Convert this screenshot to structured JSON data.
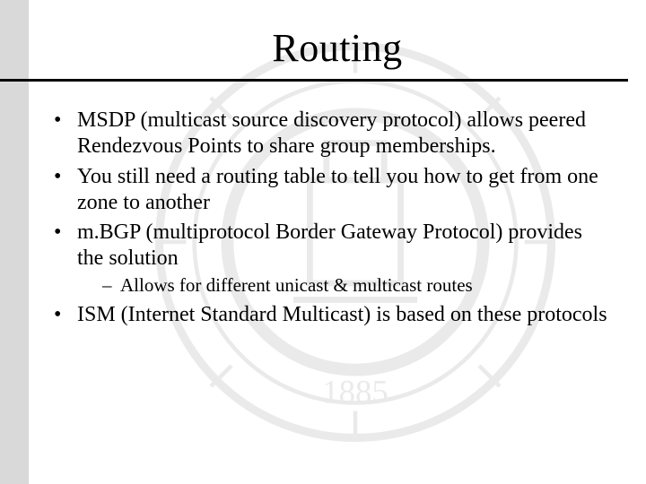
{
  "title": "Routing",
  "bullets": [
    {
      "text": "MSDP (multicast source discovery protocol) allows peered Rendezvous Points to share group memberships."
    },
    {
      "text": "You still need a routing table to tell you how to get from one zone to another"
    },
    {
      "text": "m.BGP (multiprotocol Border Gateway Protocol) provides the solution",
      "sub": [
        {
          "text": "Allows for different unicast & multicast routes"
        }
      ]
    },
    {
      "text": "ISM (Internet Standard Multicast) is based on these protocols"
    }
  ],
  "watermark": {
    "name": "institutional-seal",
    "year": "1885"
  }
}
